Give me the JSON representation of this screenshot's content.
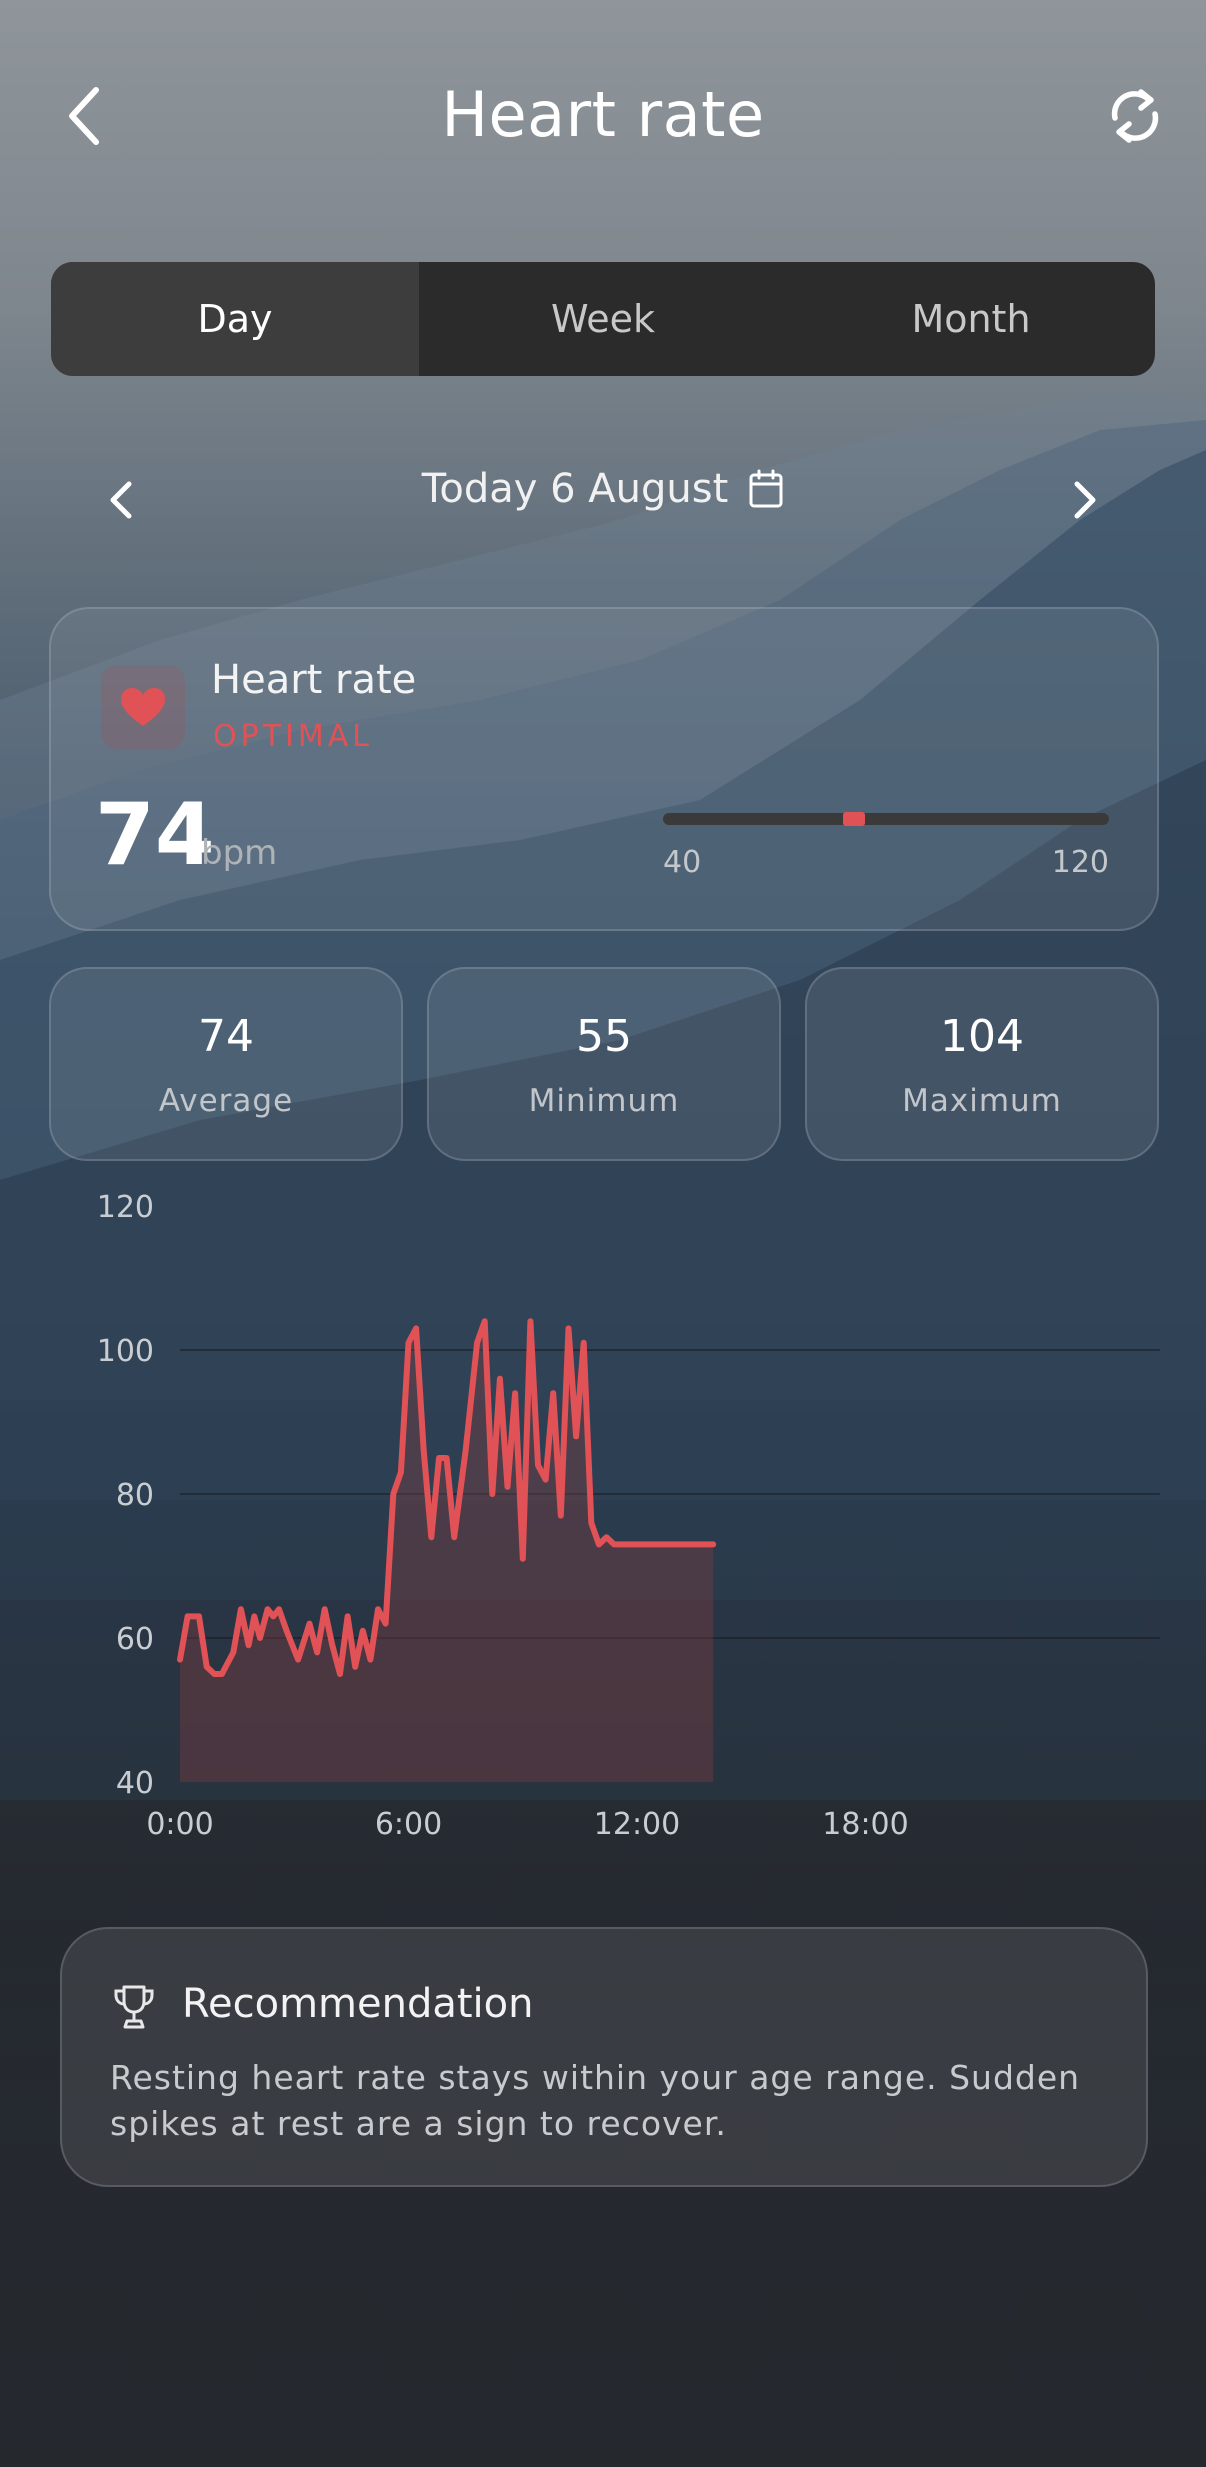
{
  "header": {
    "title": "Heart rate",
    "back_icon": "chevron-left-icon",
    "refresh_icon": "refresh-icon"
  },
  "period_tabs": [
    {
      "label": "Day",
      "active": true
    },
    {
      "label": "Week",
      "active": false
    },
    {
      "label": "Month",
      "active": false
    }
  ],
  "date_nav": {
    "label": "Today 6 August",
    "prev_icon": "chevron-left-icon",
    "next_icon": "chevron-right-icon",
    "calendar_icon": "calendar-icon"
  },
  "heart_card": {
    "title": "Heart rate",
    "status": "OPTIMAL",
    "value": "74",
    "unit": "bpm",
    "range_min": "40",
    "range_max": "120",
    "current_fraction": 0.425,
    "icon": "heart-icon",
    "accent_color": "#e05256"
  },
  "stats": [
    {
      "value": "74",
      "label": "Average"
    },
    {
      "value": "55",
      "label": "Minimum"
    },
    {
      "value": "104",
      "label": "Maximum"
    }
  ],
  "chart_data": {
    "type": "area",
    "ylim": [
      40,
      120
    ],
    "yticks": [
      "120",
      "100",
      "80",
      "60",
      "40"
    ],
    "gridlines": [
      60,
      80,
      100
    ],
    "x_ticks": [
      "0:00",
      "6:00",
      "12:00",
      "18:00"
    ],
    "x_range_hours": [
      0,
      24
    ],
    "color": "#e05256",
    "series": [
      {
        "x": [
          0,
          0.2,
          0.5,
          0.7,
          0.9,
          1.1,
          1.4,
          1.6,
          1.8,
          1.95,
          2.1,
          2.3,
          2.45,
          2.6,
          2.8,
          2.95,
          3.1,
          3.4,
          3.6,
          3.8,
          4.0,
          4.2,
          4.4,
          4.6,
          4.8,
          5.0,
          5.2,
          5.4,
          5.6,
          5.8,
          6.0,
          6.2,
          6.4,
          6.6,
          6.8,
          7.0,
          7.2,
          7.5,
          7.8,
          8.0,
          8.2,
          8.4,
          8.6,
          8.8,
          9.0,
          9.2,
          9.4,
          9.6,
          9.8,
          10.0,
          10.2,
          10.4,
          10.6,
          10.8,
          11.0,
          11.2,
          11.4,
          11.6,
          11.8,
          12.0,
          12.2,
          12.4,
          12.6,
          12.8,
          13.0,
          13.2,
          13.4,
          13.6,
          13.8,
          14.0
        ],
        "y": [
          57,
          63,
          63,
          56,
          55,
          55,
          58,
          64,
          59,
          63,
          60,
          64,
          63,
          64,
          61,
          59,
          57,
          62,
          58,
          64,
          59,
          55,
          63,
          56,
          61,
          57,
          64,
          62,
          80,
          83,
          101,
          103,
          86,
          74,
          85,
          85,
          74,
          86,
          101,
          104,
          80,
          96,
          81,
          94,
          71,
          104,
          84,
          82,
          94,
          77,
          103,
          88,
          101,
          76,
          73,
          74,
          73,
          73,
          73,
          73,
          73,
          73,
          73,
          73,
          73,
          73,
          73,
          73,
          73,
          73
        ]
      }
    ]
  },
  "recommendation": {
    "title": "Recommendation",
    "text": "Resting heart rate stays within your age range. Sudden spikes at rest are a sign to recover.",
    "icon": "trophy-icon"
  }
}
